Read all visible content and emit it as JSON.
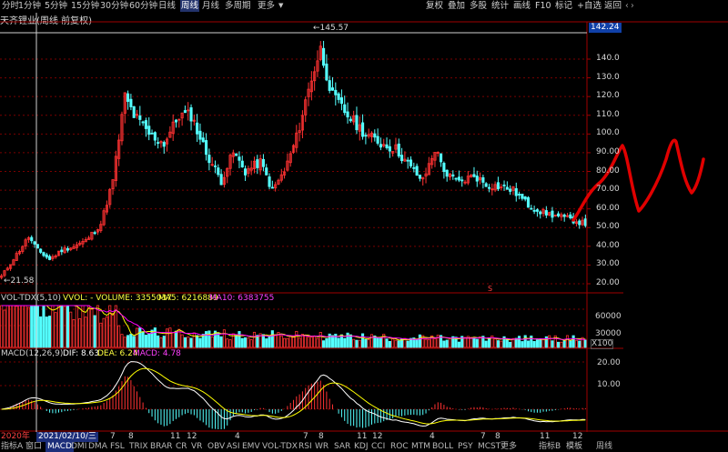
{
  "toolbar": {
    "periods": [
      {
        "label": "分时"
      },
      {
        "label": "1分钟"
      },
      {
        "label": "5分钟"
      },
      {
        "label": "15分钟"
      },
      {
        "label": "30分钟"
      },
      {
        "label": "60分钟"
      },
      {
        "label": "日线"
      },
      {
        "label": "周线",
        "active": true
      },
      {
        "label": "月线"
      },
      {
        "label": "多周期"
      },
      {
        "label": "更多"
      }
    ],
    "right": [
      {
        "label": "复权"
      },
      {
        "label": "叠加"
      },
      {
        "label": "多股"
      },
      {
        "label": "统计"
      },
      {
        "label": "画线"
      },
      {
        "label": "F10"
      },
      {
        "label": "标记"
      },
      {
        "label": "+自选"
      },
      {
        "label": "返回"
      }
    ]
  },
  "title": "天齐锂业(周线 前复权)",
  "main_chart": {
    "y_ticks": [
      "140.0",
      "130.0",
      "120.0",
      "110.0",
      "100.0",
      "90.00",
      "80.00",
      "70.00",
      "60.00",
      "50.00",
      "40.00",
      "30.00",
      "20.00"
    ],
    "current_price": "142.24",
    "high_label": "145.57",
    "low_label": "21.58",
    "marker_s": "S"
  },
  "volume_panel": {
    "header": {
      "name": "VOL-TDX(5,10)",
      "vvol": "VVOL: - VOLUME: 3355037",
      "ma5": "MA5: 6216889",
      "ma10": "MA10: 6383755"
    },
    "y_ticks": [
      "60000",
      "30000"
    ],
    "unit": "X100"
  },
  "macd_panel": {
    "header": {
      "name": "MACD(12,26,9)",
      "dif": "DIF: 8.63",
      "dea": "DEA: 6.24",
      "macd": "MACD: 4.78"
    },
    "y_ticks": [
      "20.00",
      "10.00"
    ]
  },
  "date_axis": {
    "start": "2020年",
    "selected": "2021/02/10/三",
    "months": [
      "7",
      "8",
      "11",
      "12",
      "4",
      "7",
      "8",
      "11",
      "12",
      "4",
      "7",
      "8",
      "11",
      "12"
    ]
  },
  "bottom_tabs": [
    {
      "label": "指标A"
    },
    {
      "label": "窗口"
    },
    {
      "label": "MACD",
      "active": true
    },
    {
      "label": "DMI"
    },
    {
      "label": "DMA"
    },
    {
      "label": "FSL"
    },
    {
      "label": "TRIX"
    },
    {
      "label": "BRAR"
    },
    {
      "label": "CR"
    },
    {
      "label": "VR"
    },
    {
      "label": "OBV"
    },
    {
      "label": "ASI"
    },
    {
      "label": "EMV"
    },
    {
      "label": "VOL-TDX"
    },
    {
      "label": "RSI"
    },
    {
      "label": "WR"
    },
    {
      "label": "SAR"
    },
    {
      "label": "KDJ"
    },
    {
      "label": "CCI"
    },
    {
      "label": "ROC"
    },
    {
      "label": "MTM"
    },
    {
      "label": "BOLL"
    },
    {
      "label": "PSY"
    },
    {
      "label": "MCST"
    },
    {
      "label": "更多"
    },
    {
      "label": "指标B"
    },
    {
      "label": "模板"
    },
    {
      "label": "周线"
    }
  ],
  "colors": {
    "up": "#ff3232",
    "down": "#54ffff",
    "ma5": "#ffff00",
    "ma10": "#ff00ff",
    "dif": "#ffffff",
    "dea": "#ffff00",
    "handdrawn": "#e00000",
    "grid": "#7a0000",
    "axis": "#a00000"
  }
}
